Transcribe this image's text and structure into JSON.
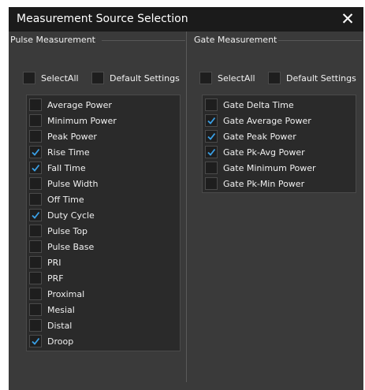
{
  "dialog": {
    "title": "Measurement Source Selection",
    "close_glyph": "✕"
  },
  "pulse": {
    "title": "Pulse Measurement",
    "select_all": "SelectAll",
    "default_settings": "Default Settings",
    "items": [
      {
        "label": "Average Power",
        "checked": false
      },
      {
        "label": "Minimum Power",
        "checked": false
      },
      {
        "label": "Peak Power",
        "checked": false
      },
      {
        "label": "Rise Time",
        "checked": true
      },
      {
        "label": "Fall Time",
        "checked": true
      },
      {
        "label": "Pulse Width",
        "checked": false
      },
      {
        "label": "Off Time",
        "checked": false
      },
      {
        "label": "Duty Cycle",
        "checked": true
      },
      {
        "label": "Pulse Top",
        "checked": false
      },
      {
        "label": "Pulse Base",
        "checked": false
      },
      {
        "label": "PRI",
        "checked": false
      },
      {
        "label": "PRF",
        "checked": false
      },
      {
        "label": "Proximal",
        "checked": false
      },
      {
        "label": "Mesial",
        "checked": false
      },
      {
        "label": "Distal",
        "checked": false
      },
      {
        "label": "Droop",
        "checked": true
      }
    ]
  },
  "gate": {
    "title": "Gate Measurement",
    "select_all": "SelectAll",
    "default_settings": "Default Settings",
    "items": [
      {
        "label": "Gate Delta Time",
        "checked": false
      },
      {
        "label": "Gate Average Power",
        "checked": true
      },
      {
        "label": "Gate Peak Power",
        "checked": true
      },
      {
        "label": "Gate Pk-Avg Power",
        "checked": true
      },
      {
        "label": "Gate Minimum Power",
        "checked": false
      },
      {
        "label": "Gate Pk-Min Power",
        "checked": false
      }
    ]
  },
  "colors": {
    "check": "#3aa0e6",
    "background": "#3a3a3a",
    "titlebar": "#1b1b1b",
    "list_background": "#2a2a2a"
  }
}
